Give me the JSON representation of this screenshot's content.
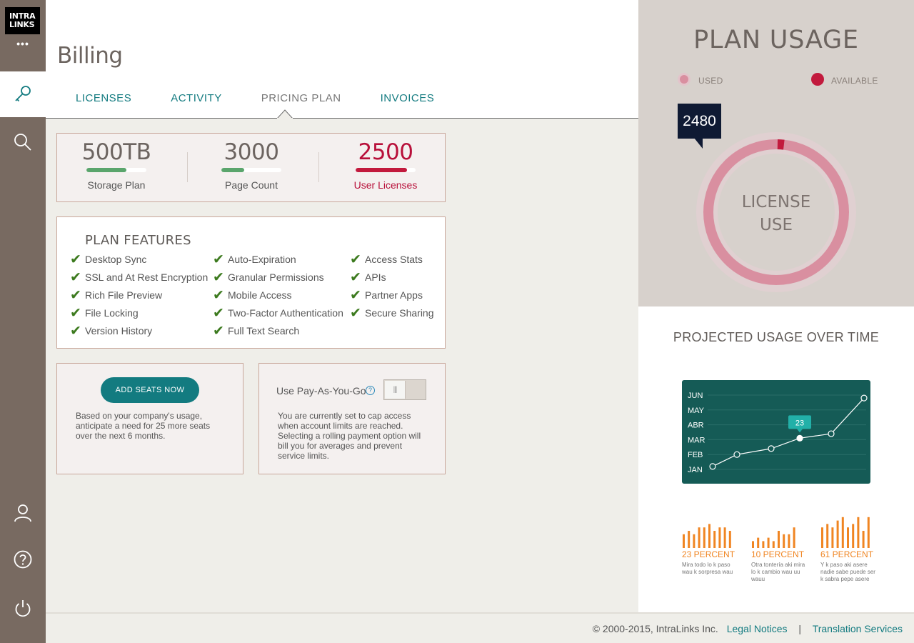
{
  "brand": {
    "logo_line1": "INTRA",
    "logo_line2": "LINKS"
  },
  "sidebar": {
    "menu_dots": "•••",
    "items": [
      {
        "name": "key-icon",
        "active": true
      },
      {
        "name": "search-icon",
        "active": false
      },
      {
        "name": "user-icon",
        "active": false
      },
      {
        "name": "help-icon",
        "active": false
      },
      {
        "name": "power-icon",
        "active": false
      }
    ]
  },
  "header": {
    "title": "Billing",
    "tabs": [
      {
        "label": "LICENSES"
      },
      {
        "label": "ACTIVITY"
      },
      {
        "label": "PRICING PLAN",
        "active": true
      },
      {
        "label": "INVOICES"
      }
    ]
  },
  "stats": [
    {
      "value": "500TB",
      "label": "Storage Plan",
      "fill": 0.67,
      "color": "#5aa56c",
      "label_color": "#555555",
      "value_color": "#6c6460"
    },
    {
      "value": "3000",
      "label": "Page Count",
      "fill": 0.38,
      "color": "#5aa56c",
      "label_color": "#555555",
      "value_color": "#6c6460"
    },
    {
      "value": "2500",
      "label": "User Licenses",
      "fill": 0.86,
      "color": "#c21a3d",
      "label_color": "#b8103a",
      "value_color": "#b8103a"
    }
  ],
  "features": {
    "title": "PLAN FEATURES",
    "check": "✔",
    "col1": [
      "Desktop Sync",
      "SSL and At Rest Encryption",
      "Rich File Preview",
      "File Locking",
      "Version History"
    ],
    "col2": [
      "Auto-Expiration",
      "Granular Permissions",
      "Mobile Access",
      "Two-Factor Authentication",
      "Full Text Search"
    ],
    "col3": [
      "Access Stats",
      "APIs",
      "Partner Apps",
      "Secure Sharing"
    ]
  },
  "seats": {
    "button": "ADD SEATS NOW",
    "description": "Based on your company's usage, anticipate a need for 25 more seats over the next 6 months."
  },
  "payg": {
    "label": "Use Pay-As-You-Go",
    "help": "?",
    "toggle_knob": "|||",
    "toggle_on": false,
    "description": "You are currently set to cap access when account limits are reached. Selecting a rolling payment option will bill you for averages and prevent service limits."
  },
  "plan_usage": {
    "title": "PLAN USAGE",
    "legend_used": "USED",
    "legend_available": "AVAILABLE",
    "used_color": "#d98fa0",
    "available_color": "#c21a3d",
    "callout": "2480",
    "donut_line1": "LICENSE",
    "donut_line2": "USE",
    "used": 2480,
    "total": 2500
  },
  "projected": {
    "title": "PROJECTED USAGE OVER TIME",
    "marker_label": "23"
  },
  "chart_data": [
    {
      "type": "line",
      "title": "PROJECTED USAGE OVER TIME",
      "y_categories": [
        "JAN",
        "FEB",
        "MAR",
        "ABR",
        "MAY",
        "JUN"
      ],
      "points": [
        0.2,
        1.0,
        1.4,
        2.1,
        2.4,
        4.8
      ],
      "highlight_index": 3,
      "highlight_label": "23",
      "ylim": [
        0,
        5
      ]
    },
    {
      "type": "bar",
      "title": "23 PERCENT",
      "values": [
        4,
        5,
        4,
        6,
        6,
        7,
        5,
        6,
        6,
        5
      ],
      "color": "#f08522"
    },
    {
      "type": "bar",
      "title": "10 PERCENT",
      "values": [
        2,
        3,
        2,
        3,
        2,
        5,
        4,
        4,
        6
      ],
      "color": "#f08522"
    },
    {
      "type": "bar",
      "title": "61 PERCENT",
      "values": [
        6,
        7,
        6,
        8,
        9,
        6,
        7,
        9,
        5,
        9
      ],
      "color": "#f08522"
    }
  ],
  "mini_stats": [
    {
      "pct": "23 PERCENT",
      "desc": "Mira todo lo k paso wau k sorpresa wau"
    },
    {
      "pct": "10 PERCENT",
      "desc": "Otra tontería aki mira lo k cambio wau uu wauu"
    },
    {
      "pct": "61 PERCENT",
      "desc": "Y k paso aki asere nadie sabe puede ser k sabra pepe asere"
    }
  ],
  "footer": {
    "copyright": "© 2000-2015, IntraLinks Inc.",
    "legal": "Legal Notices",
    "separator": "|",
    "translation": "Translation Services"
  }
}
